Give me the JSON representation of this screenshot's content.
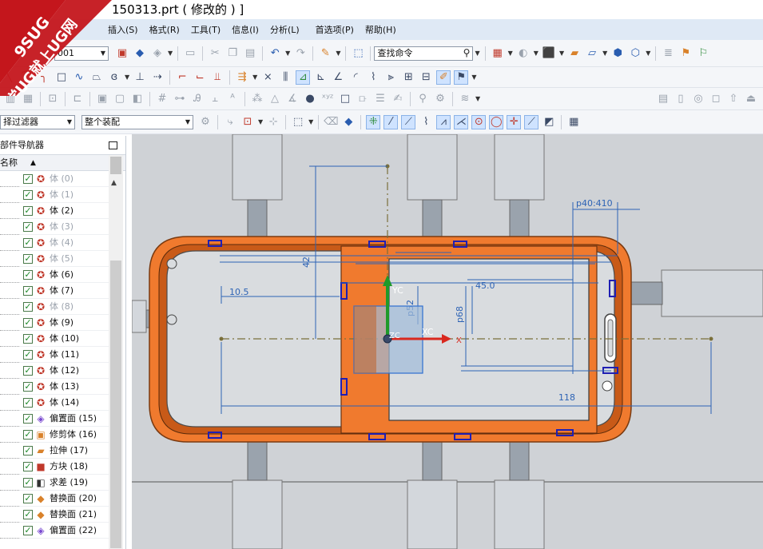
{
  "window": {
    "title": "150313.prt  ( 修改的 ) ]"
  },
  "menu": [
    "插入(S)",
    "格式(R)",
    "工具(T)",
    "信息(I)",
    "分析(L)",
    "首选项(P)",
    "帮助(H)"
  ],
  "toolbar": {
    "combo_value": "001",
    "search_placeholder": "查找命令",
    "filter_value": "择过滤器",
    "assembly_value": "整个装配"
  },
  "navigator": {
    "title": "部件导航器",
    "column_name": "名称",
    "items": [
      {
        "label": "体 (0)",
        "dim": true,
        "icon": "body"
      },
      {
        "label": "体 (1)",
        "dim": true,
        "icon": "body"
      },
      {
        "label": "体 (2)",
        "dim": false,
        "icon": "body"
      },
      {
        "label": "体 (3)",
        "dim": true,
        "icon": "body"
      },
      {
        "label": "体 (4)",
        "dim": true,
        "icon": "body"
      },
      {
        "label": "体 (5)",
        "dim": true,
        "icon": "body"
      },
      {
        "label": "体 (6)",
        "dim": false,
        "icon": "body"
      },
      {
        "label": "体 (7)",
        "dim": false,
        "icon": "body"
      },
      {
        "label": "体 (8)",
        "dim": true,
        "icon": "body"
      },
      {
        "label": "体 (9)",
        "dim": false,
        "icon": "body"
      },
      {
        "label": "体 (10)",
        "dim": false,
        "icon": "body"
      },
      {
        "label": "体 (11)",
        "dim": false,
        "icon": "body"
      },
      {
        "label": "体 (12)",
        "dim": false,
        "icon": "body"
      },
      {
        "label": "体 (13)",
        "dim": false,
        "icon": "body"
      },
      {
        "label": "体 (14)",
        "dim": false,
        "icon": "body"
      },
      {
        "label": "偏置面 (15)",
        "dim": false,
        "icon": "offset"
      },
      {
        "label": "修剪体 (16)",
        "dim": false,
        "icon": "trim"
      },
      {
        "label": "拉伸 (17)",
        "dim": false,
        "icon": "extrude"
      },
      {
        "label": "方块 (18)",
        "dim": false,
        "icon": "block"
      },
      {
        "label": "求差 (19)",
        "dim": false,
        "icon": "subtract"
      },
      {
        "label": "替换面 (20)",
        "dim": false,
        "icon": "replace"
      },
      {
        "label": "替换面 (21)",
        "dim": false,
        "icon": "replace"
      },
      {
        "label": "偏置面 (22)",
        "dim": false,
        "icon": "offset"
      }
    ]
  },
  "watermark": {
    "line1": "9SUG",
    "line2": "学UG就上UG网"
  },
  "viewport": {
    "dims": {
      "d_42": "42",
      "d_10_5": "10.5",
      "d_118": "118",
      "d_45": "45.0",
      "d_p40": "p40:410",
      "d_p52": "p52",
      "d_p68": "p68"
    },
    "csys": {
      "xc": "XC",
      "yc": "YC",
      "zc": "ZC",
      "x": "X"
    }
  }
}
